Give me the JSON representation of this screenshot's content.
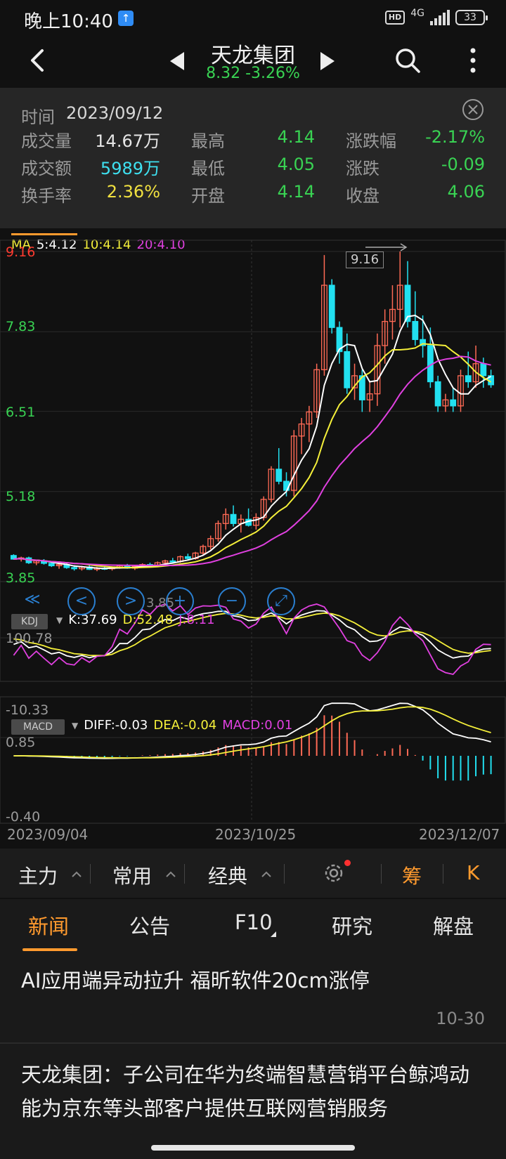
{
  "status_bar": {
    "time": "晚上10:40",
    "hd": "HD",
    "network": "4G",
    "battery": "33"
  },
  "header": {
    "stock_name": "天龙集团",
    "price_change": "8.32 -3.26%"
  },
  "info": {
    "time_label": "时间",
    "time_value": "2023/09/12",
    "rows": [
      [
        {
          "label": "成交量",
          "value": "14.67万",
          "color": "white"
        },
        {
          "label": "最高",
          "value": "4.14",
          "color": "green"
        },
        {
          "label": "涨跌幅",
          "value": "-2.17%",
          "color": "green"
        }
      ],
      [
        {
          "label": "成交额",
          "value": "5989万",
          "color": "cyan"
        },
        {
          "label": "最低",
          "value": "4.05",
          "color": "green"
        },
        {
          "label": "涨跌",
          "value": "-0.09",
          "color": "green"
        }
      ],
      [
        {
          "label": "换手率",
          "value": "2.36%",
          "color": "yellow"
        },
        {
          "label": "开盘",
          "value": "4.14",
          "color": "green"
        },
        {
          "label": "收盘",
          "value": "4.06",
          "color": "green"
        }
      ]
    ]
  },
  "chart": {
    "ma_legend": {
      "label": "MA",
      "ma5": "5:4.12",
      "ma10": "10:4.14",
      "ma20": "20:4.10"
    },
    "price_ticks": [
      {
        "label": "9.16",
        "color": "#ff3b30"
      },
      {
        "label": "7.83",
        "color": "#39d353"
      },
      {
        "label": "6.51",
        "color": "#39d353"
      },
      {
        "label": "5.18",
        "color": "#39d353"
      },
      {
        "label": "3.85",
        "color": "#39d353"
      }
    ],
    "high_marker": "9.16",
    "low_marker": "3.85",
    "kdj": {
      "badge": "KDJ",
      "k": "K:37.69",
      "d": "D:52.48",
      "j": "J:8.11",
      "top": "100.78",
      "bottom": "-10.33"
    },
    "macd": {
      "badge": "MACD",
      "diff": "DIFF:-0.03",
      "dea": "DEA:-0.04",
      "macd": "MACD:0.01",
      "top": "0.85",
      "bottom": "-0.40"
    },
    "dates": [
      "2023/09/04",
      "2023/10/25",
      "2023/12/07"
    ],
    "colors": {
      "up": "#ff6a55",
      "down": "#22e0f0",
      "ma5": "#ffffff",
      "ma10": "#f5f03a",
      "ma20": "#e040e0"
    }
  },
  "chart_data": {
    "type": "candlestick",
    "ylim": [
      3.85,
      9.16
    ],
    "candles": [
      [
        4.12,
        4.14,
        4.05,
        4.06
      ],
      [
        4.06,
        4.1,
        4.02,
        4.08
      ],
      [
        4.08,
        4.1,
        3.98,
        4.0
      ],
      [
        4.0,
        4.05,
        3.96,
        4.03
      ],
      [
        4.03,
        4.06,
        3.97,
        3.99
      ],
      [
        3.99,
        4.02,
        3.93,
        3.95
      ],
      [
        3.95,
        4.0,
        3.9,
        3.97
      ],
      [
        3.97,
        3.99,
        3.9,
        3.92
      ],
      [
        3.92,
        3.96,
        3.87,
        3.9
      ],
      [
        3.9,
        3.95,
        3.87,
        3.93
      ],
      [
        3.93,
        3.96,
        3.88,
        3.89
      ],
      [
        3.89,
        3.93,
        3.86,
        3.91
      ],
      [
        3.91,
        3.95,
        3.88,
        3.9
      ],
      [
        3.9,
        3.94,
        3.87,
        3.92
      ],
      [
        3.92,
        3.97,
        3.9,
        3.95
      ],
      [
        3.95,
        3.98,
        3.9,
        3.91
      ],
      [
        3.91,
        3.96,
        3.88,
        3.94
      ],
      [
        3.94,
        3.99,
        3.92,
        3.97
      ],
      [
        3.97,
        4.0,
        3.93,
        3.95
      ],
      [
        3.95,
        4.02,
        3.93,
        4.0
      ],
      [
        4.0,
        4.05,
        3.97,
        4.03
      ],
      [
        4.03,
        4.08,
        4.0,
        4.02
      ],
      [
        4.02,
        4.12,
        4.0,
        4.1
      ],
      [
        4.1,
        4.15,
        4.05,
        4.07
      ],
      [
        4.07,
        4.18,
        4.05,
        4.16
      ],
      [
        4.16,
        4.3,
        4.12,
        4.27
      ],
      [
        4.27,
        4.45,
        4.22,
        4.4
      ],
      [
        4.4,
        4.7,
        4.35,
        4.65
      ],
      [
        4.65,
        4.9,
        4.55,
        4.8
      ],
      [
        4.8,
        4.95,
        4.6,
        4.65
      ],
      [
        4.65,
        4.8,
        4.5,
        4.72
      ],
      [
        4.72,
        4.9,
        4.6,
        4.62
      ],
      [
        4.62,
        4.82,
        4.55,
        4.75
      ],
      [
        4.75,
        5.1,
        4.7,
        5.05
      ],
      [
        5.05,
        5.6,
        5.0,
        5.55
      ],
      [
        5.55,
        5.9,
        5.3,
        5.35
      ],
      [
        5.35,
        5.5,
        5.1,
        5.2
      ],
      [
        5.2,
        6.2,
        5.1,
        6.1
      ],
      [
        6.1,
        6.4,
        5.8,
        6.3
      ],
      [
        6.3,
        6.6,
        6.0,
        6.5
      ],
      [
        6.5,
        7.3,
        6.4,
        7.2
      ],
      [
        7.2,
        9.1,
        7.1,
        8.6
      ],
      [
        8.6,
        8.7,
        7.8,
        7.9
      ],
      [
        7.9,
        8.0,
        7.3,
        7.5
      ],
      [
        7.5,
        7.8,
        6.8,
        6.9
      ],
      [
        6.9,
        7.3,
        6.7,
        7.1
      ],
      [
        7.1,
        7.2,
        6.5,
        6.7
      ],
      [
        6.7,
        7.0,
        6.5,
        6.8
      ],
      [
        6.8,
        7.8,
        6.6,
        7.6
      ],
      [
        7.6,
        8.2,
        7.3,
        8.0
      ],
      [
        8.0,
        8.6,
        7.7,
        8.2
      ],
      [
        8.2,
        9.16,
        7.9,
        8.6
      ],
      [
        8.6,
        9.0,
        7.9,
        8.0
      ],
      [
        8.0,
        8.5,
        7.6,
        7.7
      ],
      [
        7.7,
        8.1,
        7.4,
        7.6
      ],
      [
        7.6,
        7.9,
        6.9,
        7.0
      ],
      [
        7.0,
        7.1,
        6.5,
        6.6
      ],
      [
        6.6,
        6.8,
        6.5,
        6.7
      ],
      [
        6.7,
        6.9,
        6.5,
        6.6
      ],
      [
        6.6,
        7.2,
        6.5,
        7.1
      ],
      [
        7.1,
        7.5,
        6.9,
        7.0
      ],
      [
        7.0,
        7.6,
        6.9,
        7.3
      ],
      [
        7.3,
        7.4,
        6.9,
        7.1
      ],
      [
        7.1,
        7.2,
        6.9,
        6.95
      ]
    ]
  },
  "zoom_controls": {
    "left2": "≪",
    "left": "<",
    "right": ">",
    "plus": "+",
    "minus": "−",
    "expand": "⤢"
  },
  "bottom_tabs": {
    "main": "主力",
    "common": "常用",
    "classic": "经典",
    "chip": "筹",
    "k": "K"
  },
  "news_tabs": [
    "新闻",
    "公告",
    "F10",
    "研究",
    "解盘"
  ],
  "news": [
    {
      "title": "AI应用端异动拉升 福昕软件20cm涨停",
      "date": "10-30"
    },
    {
      "title": "天龙集团：子公司在华为终端智慧营销平台鲸鸿动能为京东等头部客户提供互联网营销服务",
      "date": ""
    }
  ]
}
